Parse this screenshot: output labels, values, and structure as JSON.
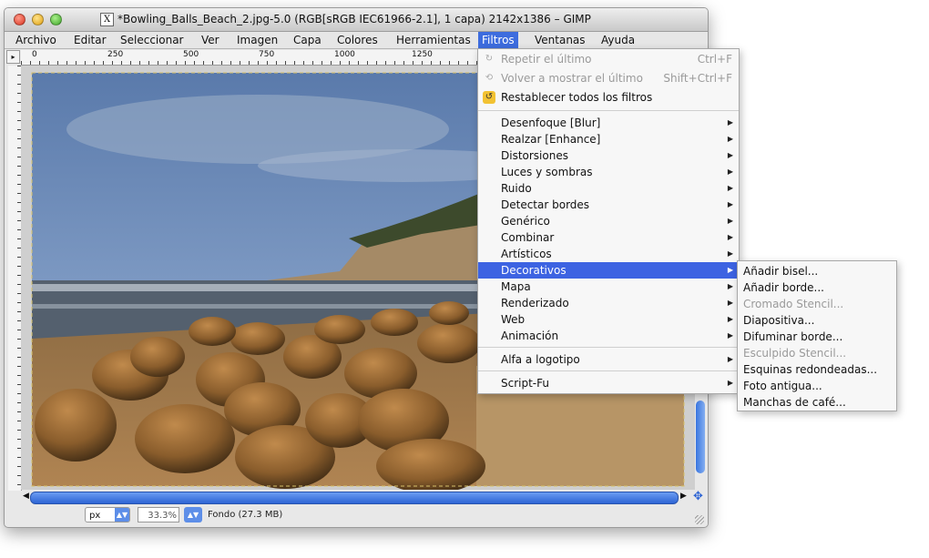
{
  "window": {
    "title": "*Bowling_Balls_Beach_2.jpg-5.0 (RGB[sRGB IEC61966-2.1], 1 capa) 2142x1386 – GIMP",
    "x_icon": "X"
  },
  "menubar": [
    {
      "label": "Archivo"
    },
    {
      "label": "Editar"
    },
    {
      "label": "Seleccionar"
    },
    {
      "label": "Ver"
    },
    {
      "label": "Imagen"
    },
    {
      "label": "Capa"
    },
    {
      "label": "Colores"
    },
    {
      "label": "Herramientas"
    },
    {
      "label": "Filtros"
    },
    {
      "label": "Ventanas"
    },
    {
      "label": "Ayuda"
    }
  ],
  "ruler": {
    "corner": "▸",
    "top_labels": [
      "0",
      "250",
      "500",
      "750",
      "1000",
      "1250"
    ],
    "left_labels": [
      "2",
      "5",
      "7",
      "1",
      "1",
      "2"
    ]
  },
  "filters_menu": {
    "items": [
      {
        "label": "Repetir el último",
        "accel": "Ctrl+F",
        "state": "disabled",
        "icon": "repeat-icon"
      },
      {
        "label": "Volver a mostrar el último",
        "accel": "Shift+Ctrl+F",
        "state": "disabled",
        "icon": "reshow-icon"
      },
      {
        "label": "Restablecer todos los filtros",
        "accel": "",
        "state": "enabled",
        "icon": "reset-filters-icon"
      },
      {
        "label": "Desenfoque [Blur]",
        "submenu": true
      },
      {
        "label": "Realzar [Enhance]",
        "submenu": true
      },
      {
        "label": "Distorsiones",
        "submenu": true
      },
      {
        "label": "Luces y sombras",
        "submenu": true
      },
      {
        "label": "Ruido",
        "submenu": true
      },
      {
        "label": "Detectar bordes",
        "submenu": true
      },
      {
        "label": "Genérico",
        "submenu": true
      },
      {
        "label": "Combinar",
        "submenu": true
      },
      {
        "label": "Artísticos",
        "submenu": true
      },
      {
        "label": "Decorativos",
        "submenu": true,
        "highlighted": true
      },
      {
        "label": "Mapa",
        "submenu": true
      },
      {
        "label": "Renderizado",
        "submenu": true
      },
      {
        "label": "Web",
        "submenu": true
      },
      {
        "label": "Animación",
        "submenu": true
      },
      {
        "label": "Alfa a logotipo",
        "submenu": true
      },
      {
        "label": "Script-Fu",
        "submenu": true
      }
    ]
  },
  "decorativos_submenu": {
    "items": [
      {
        "label": "Añadir bisel...",
        "state": "enabled"
      },
      {
        "label": "Añadir borde...",
        "state": "enabled"
      },
      {
        "label": "Cromado Stencil...",
        "state": "disabled"
      },
      {
        "label": "Diapositiva...",
        "state": "enabled"
      },
      {
        "label": "Difuminar borde...",
        "state": "enabled"
      },
      {
        "label": "Esculpido Stencil...",
        "state": "disabled"
      },
      {
        "label": "Esquinas redondeadas...",
        "state": "enabled"
      },
      {
        "label": "Foto antigua...",
        "state": "enabled"
      },
      {
        "label": "Manchas de café...",
        "state": "enabled"
      }
    ]
  },
  "statusbar": {
    "unit": "px",
    "zoom": "33.3%",
    "layer_info": "Fondo (27.3 MB)"
  },
  "colors": {
    "highlight": "#3d63e2",
    "sky": "#4a6a9e",
    "sand": "#a67a45"
  }
}
